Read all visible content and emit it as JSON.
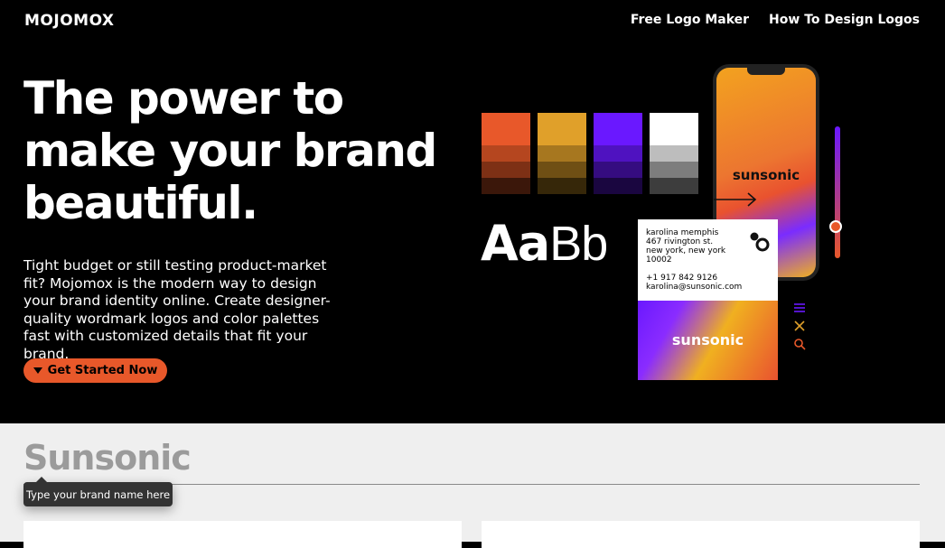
{
  "brand": {
    "logo": "MOJOMOX"
  },
  "nav": {
    "items": [
      "Free Logo Maker",
      "How To Design Logos"
    ]
  },
  "hero": {
    "headline_lines": [
      "The power to",
      "make your brand",
      "beautiful."
    ],
    "description": "Tight budget or still testing product-market fit? Mojomox is the modern way to design your brand identity online. Create designer-quality wordmark logos and color palettes fast with customized details that fit your brand.",
    "cta_label": "Get Started Now"
  },
  "preview": {
    "type_sample_bold": "Aa",
    "type_sample_light": "Bb",
    "phone_brand": "sunsonic",
    "card": {
      "name": "karolina memphis",
      "address1": "467 rivington st.",
      "address2": "new york, new york",
      "zip": "10002",
      "phone": "+1 917 842 9126",
      "email": "karolina@sunsonic.com",
      "brand": "sunsonic"
    },
    "swatches": [
      [
        "#e8582a",
        "#b5461f",
        "#7d3015",
        "#3b170a"
      ],
      [
        "#e0a02a",
        "#a7771f",
        "#6f4f14",
        "#362709"
      ],
      [
        "#6a18ff",
        "#4f12c0",
        "#350c80",
        "#1a0640"
      ],
      [
        "#ffffff",
        "#bdbdbd",
        "#7d7d7d",
        "#3d3d3d"
      ]
    ],
    "slider_level": 0.76,
    "colors": {
      "accent": "#e8582a",
      "purple": "#6a18ff"
    },
    "icons": [
      "hamburger-icon",
      "close-icon",
      "search-icon"
    ]
  },
  "editor": {
    "brand_name_value": "Sunsonic",
    "tooltip": "Type your brand name here"
  }
}
